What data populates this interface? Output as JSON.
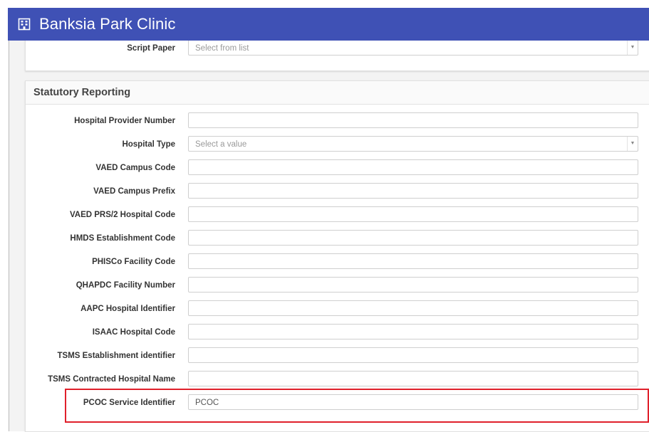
{
  "app": {
    "title": "Banksia Park Clinic"
  },
  "prev_section": {
    "field": {
      "label": "Script Paper",
      "placeholder": "Select from list"
    }
  },
  "section": {
    "title": "Statutory Reporting",
    "fields": [
      {
        "label": "Hospital Provider Number",
        "value": ""
      },
      {
        "label": "Hospital Type",
        "placeholder": "Select a value"
      },
      {
        "label": "VAED Campus Code",
        "value": ""
      },
      {
        "label": "VAED Campus Prefix",
        "value": ""
      },
      {
        "label": "VAED PRS/2 Hospital Code",
        "value": ""
      },
      {
        "label": "HMDS Establishment Code",
        "value": ""
      },
      {
        "label": "PHISCo Facility Code",
        "value": ""
      },
      {
        "label": "QHAPDC Facility Number",
        "value": ""
      },
      {
        "label": "AAPC Hospital Identifier",
        "value": ""
      },
      {
        "label": "ISAAC Hospital Code",
        "value": ""
      },
      {
        "label": "TSMS Establishment identifier",
        "value": ""
      },
      {
        "label": "TSMS Contracted Hospital Name",
        "value": ""
      },
      {
        "label": "PCOC Service Identifier",
        "value": "PCOC"
      }
    ]
  },
  "colors": {
    "topbar": "#3f51b5",
    "highlight": "#e0202b"
  },
  "icons": {
    "app": "building-icon",
    "dropdown": "caret-down-icon"
  }
}
